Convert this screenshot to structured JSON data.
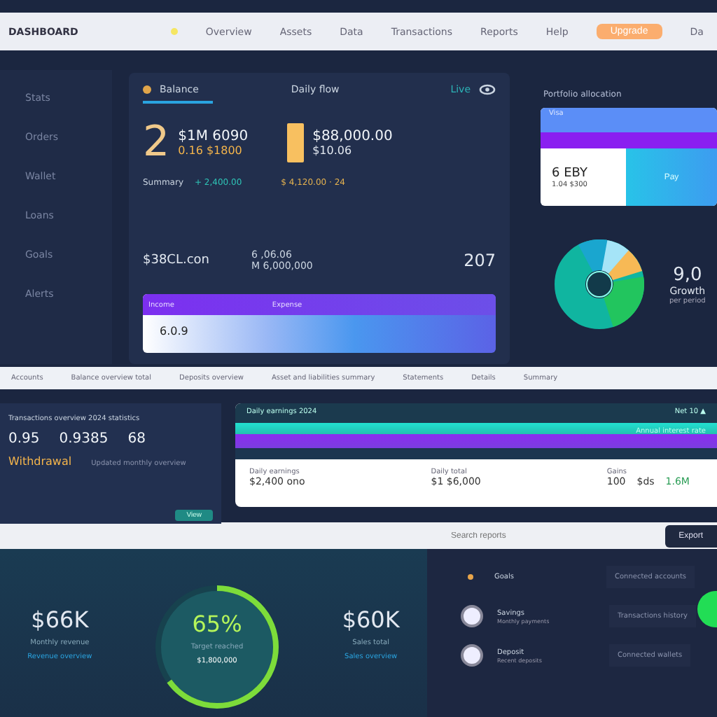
{
  "nav": {
    "brand": "DASHBOARD",
    "items": [
      "Overview",
      "Assets",
      "Data",
      "Transactions",
      "Reports",
      "Help"
    ],
    "cta": "Upgrade",
    "tail": "Da"
  },
  "sidebar": {
    "items": [
      {
        "label": "Stats",
        "selected": false
      },
      {
        "label": "Orders",
        "selected": false
      },
      {
        "label": "Wallet",
        "selected": false
      },
      {
        "label": "Loans",
        "selected": false
      },
      {
        "label": "Goals",
        "selected": false
      },
      {
        "label": "Alerts",
        "selected": false
      }
    ]
  },
  "main_card": {
    "title": "Balance",
    "subtitle": "Daily flow",
    "tag": "Live",
    "big": "2",
    "stat_value": "$1M 6090",
    "stat_sub": "0.16 $1800",
    "stat2_value": "$88,000.00",
    "stat2_sub": "$10.06",
    "link1": "Summary",
    "link2": "+ 2,400.00",
    "note": "$ 4,120.00 · 24",
    "row_value": "$38CL.con",
    "row_label": "6 ,06.06",
    "row_sub": "M 6,000,000",
    "row_num": "207",
    "bar_left": "Income",
    "bar_right": "Expense",
    "bar_value": "6.0.9"
  },
  "right": {
    "title": "Portfolio allocation",
    "card_top": "Visa",
    "card_value": "6 EBY",
    "card_sub": "1.04 $300",
    "card_action": "Pay",
    "donut_value": "9,0",
    "donut_label": "Growth",
    "donut_sub": "per period"
  },
  "strip": [
    "Accounts",
    "Balance overview total",
    "Deposits overview",
    "Asset and liabilities summary",
    "Statements",
    "Details",
    "Summary"
  ],
  "summary": {
    "title": "Transactions overview 2024 statistics",
    "v1": "0.95",
    "v2": "0.9385",
    "v3": "68",
    "label": "Withdrawal",
    "sub": "Updated monthly overview",
    "action": "View"
  },
  "earnings": {
    "head_left": "Daily earnings 2024",
    "head_right": "Net 10 ▲",
    "sub_right": "Annual interest rate",
    "c1_label": "Daily earnings",
    "c1_value": "$2,400 ono",
    "c2_label": "Daily total",
    "c2_value": "$1 $6,000",
    "c3_label": "Gains",
    "c3_a": "100",
    "c3_b": "$ds",
    "c3_c": "1.6M"
  },
  "searchbar": {
    "placeholder": "Search reports",
    "button": "Export"
  },
  "gauges": {
    "left_value": "$66K",
    "left_sub": "Monthly revenue",
    "left_link": "Revenue overview",
    "center_value": "65%",
    "center_sub": "Target reached",
    "center_sub2": "$1,800,000",
    "right_value": "$60K",
    "right_sub": "Sales total",
    "right_link": "Sales overview"
  },
  "list": [
    {
      "title": "Goals",
      "value": "Connected accounts"
    },
    {
      "title": "Savings",
      "sub": "Monthly payments",
      "value": "Transactions history"
    },
    {
      "title": "Deposit",
      "sub": "Recent deposits",
      "value": "Connected wallets"
    }
  ]
}
